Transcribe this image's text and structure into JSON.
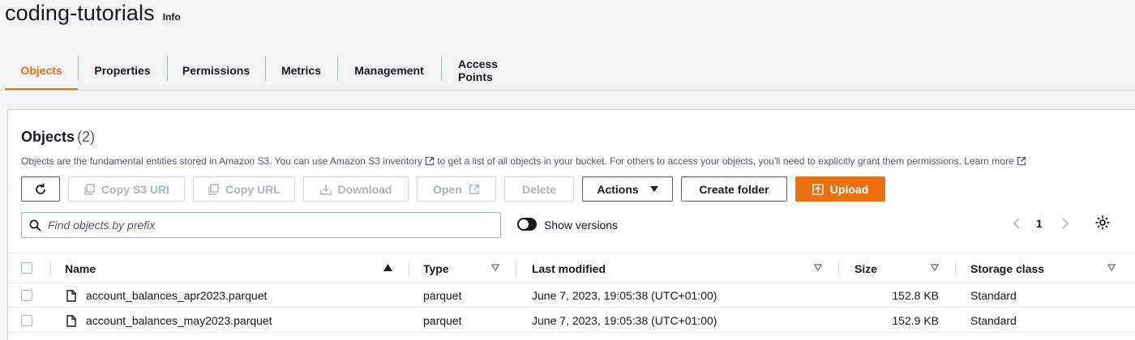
{
  "header": {
    "title": "coding-tutorials",
    "info_label": "Info"
  },
  "tabs": [
    {
      "label": "Objects",
      "active": true
    },
    {
      "label": "Properties"
    },
    {
      "label": "Permissions"
    },
    {
      "label": "Metrics"
    },
    {
      "label": "Management"
    },
    {
      "label": "Access Points"
    }
  ],
  "panel": {
    "title": "Objects",
    "count": "(2)",
    "desc_part1": "Objects are the fundamental entities stored in Amazon S3. You can use ",
    "desc_link": "Amazon S3 inventory",
    "desc_part2": " to get a list of all objects in your bucket. For others to access your objects, you'll need to explicitly grant them permissions. ",
    "learn_more": "Learn more"
  },
  "toolbar": {
    "copy_s3_uri": "Copy S3 URI",
    "copy_url": "Copy URL",
    "download": "Download",
    "open": "Open",
    "delete": "Delete",
    "actions": "Actions",
    "create_folder": "Create folder",
    "upload": "Upload"
  },
  "search": {
    "placeholder": "Find objects by prefix"
  },
  "versions": {
    "label": "Show versions",
    "enabled": false
  },
  "pagination": {
    "current_page": "1"
  },
  "table": {
    "columns": [
      "Name",
      "Type",
      "Last modified",
      "Size",
      "Storage class"
    ],
    "rows": [
      {
        "name": "account_balances_apr2023.parquet",
        "type": "parquet",
        "last_modified": "June 7, 2023, 19:05:38 (UTC+01:00)",
        "size": "152.8 KB",
        "storage_class": "Standard"
      },
      {
        "name": "account_balances_may2023.parquet",
        "type": "parquet",
        "last_modified": "June 7, 2023, 19:05:38 (UTC+01:00)",
        "size": "152.9 KB",
        "storage_class": "Standard"
      }
    ]
  },
  "colors": {
    "accent": "#ec7211",
    "text": "#16191f",
    "muted": "#545b64",
    "disabled": "#aab7b8",
    "border": "#d5dbdb",
    "background": "#f2f3f3"
  }
}
